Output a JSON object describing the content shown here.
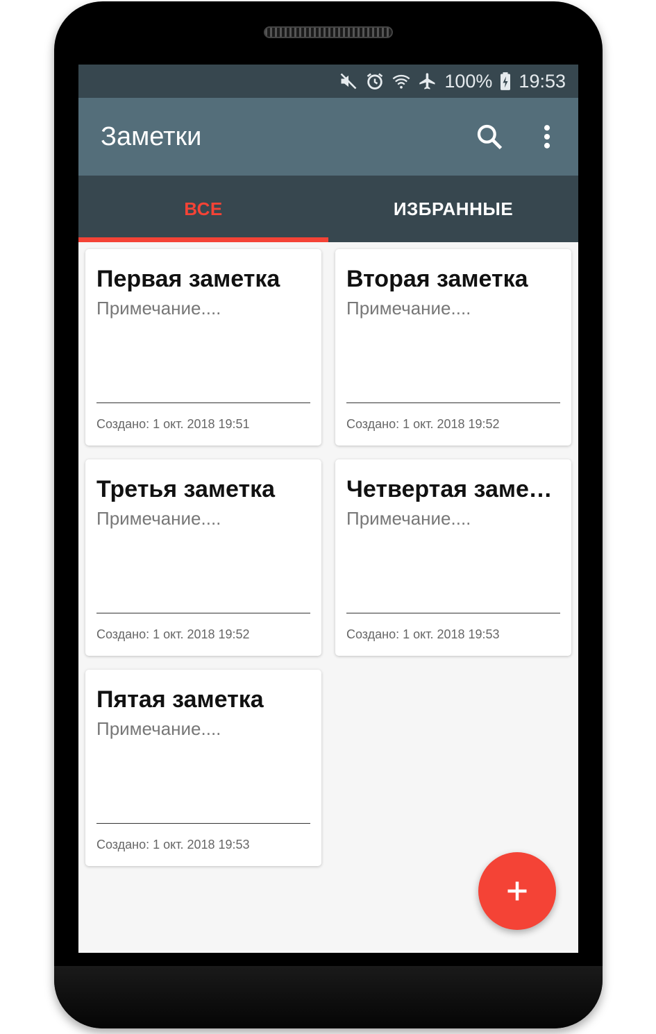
{
  "status_bar": {
    "battery": "100%",
    "time": "19:53",
    "icons": [
      "mute-icon",
      "alarm-icon",
      "wifi-icon",
      "airplane-icon",
      "battery-charging-icon"
    ]
  },
  "app_bar": {
    "title": "Заметки",
    "actions": [
      "search-icon",
      "more-vert-icon"
    ]
  },
  "tabs": [
    {
      "label": "ВСЕ",
      "active": true
    },
    {
      "label": "ИЗБРАННЫЕ",
      "active": false
    }
  ],
  "notes": [
    {
      "title": "Первая заметка",
      "note": "Примечание....",
      "created": "Создано: 1 окт. 2018 19:51"
    },
    {
      "title": "Вторая заметка",
      "note": "Примечание....",
      "created": "Создано: 1 окт. 2018 19:52"
    },
    {
      "title": "Третья заметка",
      "note": "Примечание....",
      "created": "Создано: 1 окт. 2018 19:52"
    },
    {
      "title": "Четвертая заметка",
      "note": "Примечание....",
      "created": "Создано: 1 окт. 2018 19:53"
    },
    {
      "title": "Пятая заметка",
      "note": "Примечание....",
      "created": "Создано: 1 окт. 2018 19:53"
    }
  ],
  "fab": {
    "icon": "add-icon"
  },
  "colors": {
    "status_bar": "#37474f",
    "app_bar": "#546e7a",
    "accent": "#f44336",
    "background": "#f6f6f6"
  }
}
